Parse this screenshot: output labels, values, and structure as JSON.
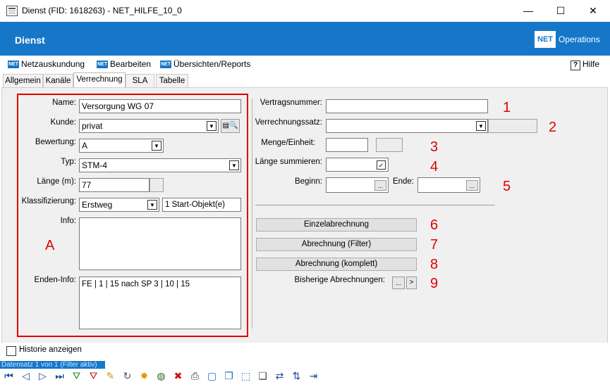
{
  "window": {
    "title": "Dienst (FID: 1618263) - NET_HILFE_10_0",
    "minimize": "—",
    "maximize": "☐",
    "close": "✕"
  },
  "header": {
    "title": "Dienst",
    "logo_text": "NET",
    "logo_caption": "Operations"
  },
  "menu": {
    "items": [
      {
        "label": "Netzauskundung"
      },
      {
        "label": "Bearbeiten"
      },
      {
        "label": "Übersichten/Reports"
      }
    ],
    "help_icon": "?",
    "help_label": "Hilfe"
  },
  "tabs": [
    {
      "label": "Allgemein"
    },
    {
      "label": "Kanäle"
    },
    {
      "label": "Verrechnung",
      "active": true
    },
    {
      "label": "SLA"
    },
    {
      "label": "Tabelle"
    }
  ],
  "left": {
    "name_label": "Name:",
    "name_value": "Versorgung WG 07",
    "kunde_label": "Kunde:",
    "kunde_value": "privat",
    "bewertung_label": "Bewertung:",
    "bewertung_value": "A",
    "typ_label": "Typ:",
    "typ_value": "STM-4",
    "laenge_label": "Länge (m):",
    "laenge_value": "77",
    "klass_label": "Klassifizierung:",
    "klass_value": "Erstweg",
    "klass_count": "1 Start-Objekt(e)",
    "info_label": "Info:",
    "info_value": "",
    "enden_label": "Enden-Info:",
    "enden_value": "FE | 1 | 15 nach SP 3 | 10 | 15",
    "marker": "A"
  },
  "right": {
    "vertrag_label": "Vertragsnummer:",
    "vertrag_value": "",
    "satz_label": "Verrechnungssatz:",
    "satz_value": "",
    "menge_label": "Menge/Einheit:",
    "laenge_sum_label": "Länge summieren:",
    "laenge_sum_check": "✓",
    "beginn_label": "Beginn:",
    "ende_label": "Ende:",
    "ellipsis": "...",
    "btn_einzel": "Einzelabrechnung",
    "btn_filter": "Abrechnung (Filter)",
    "btn_komplett": "Abrechnung (komplett)",
    "bisherige_label": "Bisherige Abrechnungen:",
    "next_arrow": ">",
    "numbers": [
      "1",
      "2",
      "3",
      "4",
      "5",
      "6",
      "7",
      "8",
      "9"
    ]
  },
  "footer": {
    "history_label": "Historie anzeigen",
    "status_text": "Datensatz 1 von 1 (Filter aktiv)"
  },
  "toolbar_icons": [
    "first-record-icon",
    "previous-record-icon",
    "next-record-icon",
    "last-record-icon",
    "filter-add-icon",
    "filter-remove-icon",
    "edit-icon",
    "refresh-icon",
    "new-icon",
    "globe-icon",
    "delete-icon",
    "print-icon",
    "copy-icon",
    "duplicate-icon",
    "select-icon",
    "layers-icon",
    "transfer-icon",
    "columns-icon",
    "exit-icon"
  ],
  "colors": {
    "accent": "#1677c9",
    "annotation_red": "#e00000"
  }
}
